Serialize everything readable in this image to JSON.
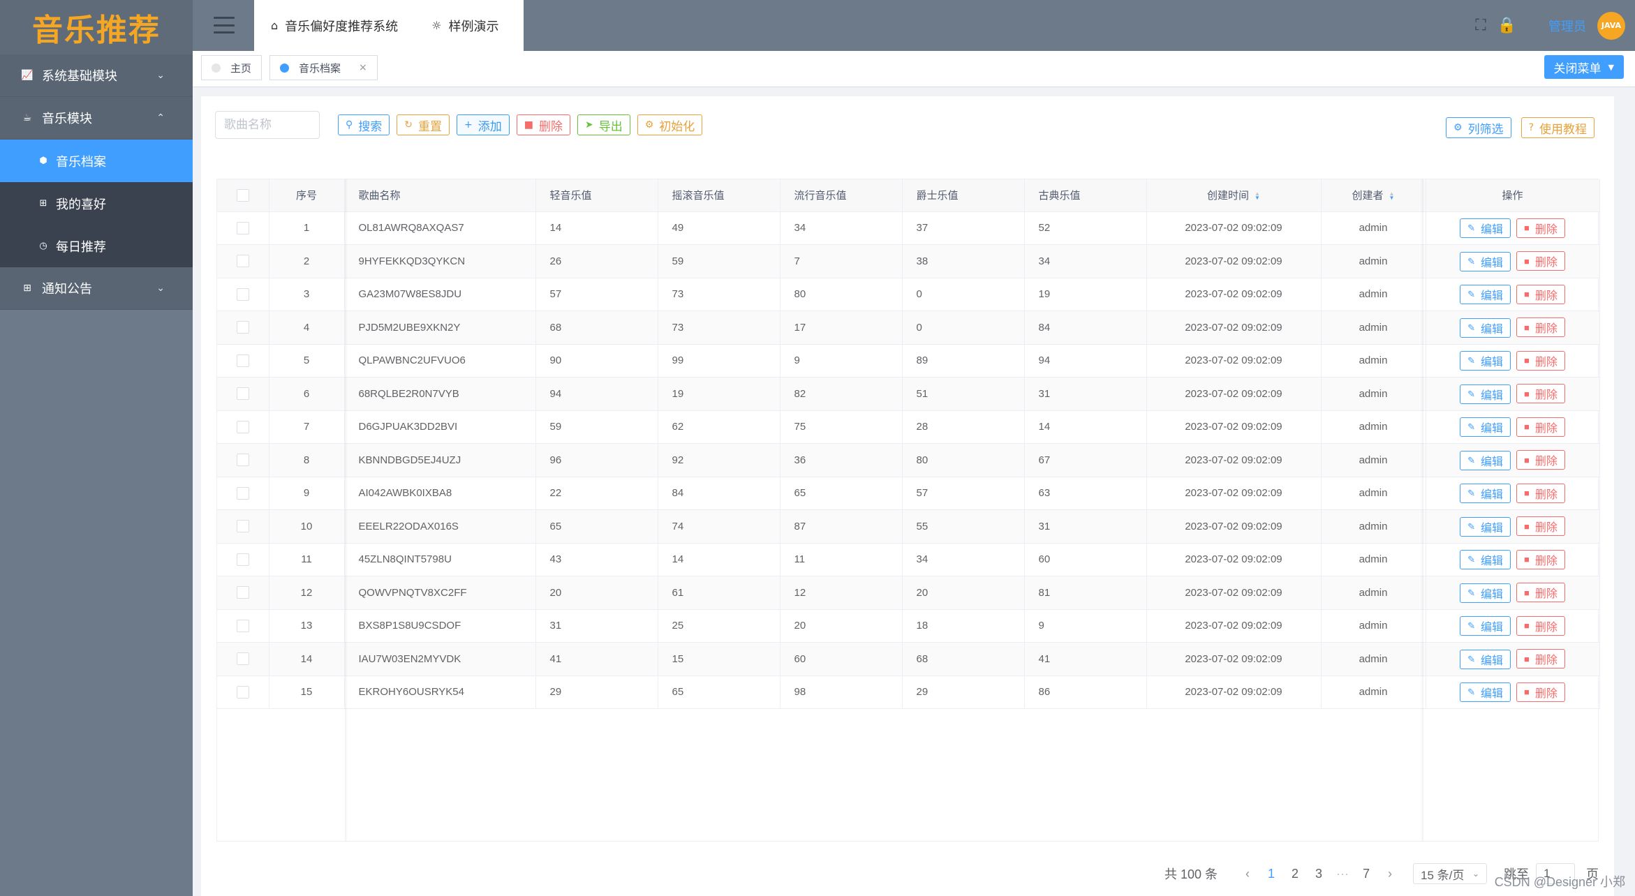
{
  "logo": {
    "text": "音乐推荐"
  },
  "sidebar": {
    "items": [
      {
        "label": "系统基础模块",
        "icon": "chart-icon",
        "expanded": false
      },
      {
        "label": "音乐模块",
        "icon": "coffee-icon",
        "expanded": true,
        "children": [
          {
            "label": "音乐档案",
            "icon": "cube-icon",
            "active": true
          },
          {
            "label": "我的喜好",
            "icon": "plus-square-icon"
          },
          {
            "label": "每日推荐",
            "icon": "clock-icon"
          }
        ]
      },
      {
        "label": "通知公告",
        "icon": "plus-square-icon",
        "expanded": false
      }
    ]
  },
  "header": {
    "tabs": [
      {
        "label": "音乐偏好度推荐系统",
        "icon": "home-icon"
      },
      {
        "label": "样例演示",
        "icon": "bulb-icon"
      }
    ],
    "user": {
      "name": "管理员"
    },
    "avatar_text": "JAVA"
  },
  "tags": {
    "items": [
      {
        "label": "主页",
        "active": false
      },
      {
        "label": "音乐档案",
        "active": true,
        "close": "×"
      }
    ],
    "close_menu": "关闭菜单"
  },
  "toolbar": {
    "search_placeholder": "歌曲名称",
    "search": "搜索",
    "reset": "重置",
    "add": "添加",
    "delete": "删除",
    "export": "导出",
    "init": "初始化",
    "columns": "列筛选",
    "tutorial": "使用教程"
  },
  "table": {
    "headers": [
      "序号",
      "歌曲名称",
      "轻音乐值",
      "摇滚音乐值",
      "流行音乐值",
      "爵士乐值",
      "古典乐值",
      "创建时间",
      "创建者",
      "操作"
    ],
    "edit_label": "编辑",
    "delete_label": "删除",
    "rows": [
      [
        "1",
        "OL81AWRQ8AXQAS7",
        "14",
        "49",
        "34",
        "37",
        "52",
        "2023-07-02 09:02:09",
        "admin"
      ],
      [
        "2",
        "9HYFEKKQD3QYKCN",
        "26",
        "59",
        "7",
        "38",
        "34",
        "2023-07-02 09:02:09",
        "admin"
      ],
      [
        "3",
        "GA23M07W8ES8JDU",
        "57",
        "73",
        "80",
        "0",
        "19",
        "2023-07-02 09:02:09",
        "admin"
      ],
      [
        "4",
        "PJD5M2UBE9XKN2Y",
        "68",
        "73",
        "17",
        "0",
        "84",
        "2023-07-02 09:02:09",
        "admin"
      ],
      [
        "5",
        "QLPAWBNC2UFVUO6",
        "90",
        "99",
        "9",
        "89",
        "94",
        "2023-07-02 09:02:09",
        "admin"
      ],
      [
        "6",
        "68RQLBE2R0N7VYB",
        "94",
        "19",
        "82",
        "51",
        "31",
        "2023-07-02 09:02:09",
        "admin"
      ],
      [
        "7",
        "D6GJPUAK3DD2BVI",
        "59",
        "62",
        "75",
        "28",
        "14",
        "2023-07-02 09:02:09",
        "admin"
      ],
      [
        "8",
        "KBNNDBGD5EJ4UZJ",
        "96",
        "92",
        "36",
        "80",
        "67",
        "2023-07-02 09:02:09",
        "admin"
      ],
      [
        "9",
        "AI042AWBK0IXBA8",
        "22",
        "84",
        "65",
        "57",
        "63",
        "2023-07-02 09:02:09",
        "admin"
      ],
      [
        "10",
        "EEELR22ODAX016S",
        "65",
        "74",
        "87",
        "55",
        "31",
        "2023-07-02 09:02:09",
        "admin"
      ],
      [
        "11",
        "45ZLN8QINT5798U",
        "43",
        "14",
        "11",
        "34",
        "60",
        "2023-07-02 09:02:09",
        "admin"
      ],
      [
        "12",
        "QOWVPNQTV8XC2FF",
        "20",
        "61",
        "12",
        "20",
        "81",
        "2023-07-02 09:02:09",
        "admin"
      ],
      [
        "13",
        "BXS8P1S8U9CSDOF",
        "31",
        "25",
        "20",
        "18",
        "9",
        "2023-07-02 09:02:09",
        "admin"
      ],
      [
        "14",
        "IAU7W03EN2MYVDK",
        "41",
        "15",
        "60",
        "68",
        "41",
        "2023-07-02 09:02:09",
        "admin"
      ],
      [
        "15",
        "EKROHY6OUSRYK54",
        "29",
        "65",
        "98",
        "29",
        "86",
        "2023-07-02 09:02:09",
        "admin"
      ]
    ]
  },
  "pagination": {
    "total": "共 100 条",
    "pages": [
      "1",
      "2",
      "3",
      "7"
    ],
    "current": "1",
    "more": "···",
    "page_size": "15 条/页",
    "jump_label": "跳至",
    "jump_value": "1",
    "page_suffix": "页"
  },
  "watermark": "CSDN @Designer 小郑",
  "colors": {
    "primary": "#409eff",
    "sidebar": "#6d7a89",
    "logo": "#f5a623",
    "danger": "#f56c6c",
    "warning": "#e6a23c",
    "success": "#67c23a"
  }
}
